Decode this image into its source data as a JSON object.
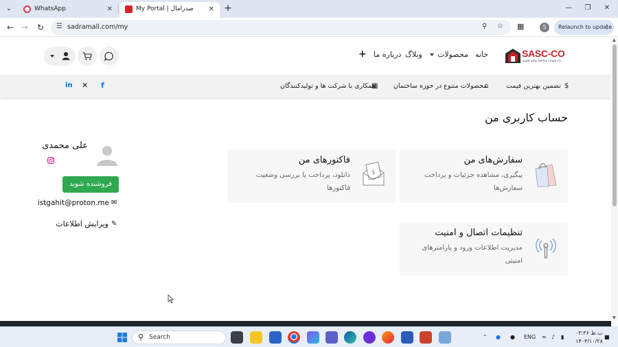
{
  "browser": {
    "tabs": [
      {
        "title": "WhatsApp",
        "active": false
      },
      {
        "title": "My Portal | صدرامال",
        "active": true
      }
    ],
    "url": "sadramall.com/my",
    "profile_initial": "S",
    "relaunch_label": "Relaunch to update"
  },
  "site": {
    "logo_name": "SASC-CO",
    "logo_sub": "SADR ASIA SUPPLY CHAIN CO",
    "menu": {
      "home": "خانه",
      "products": "محصولات",
      "blog": "وبلاگ",
      "about": "درباره ما"
    },
    "info": {
      "best_price": "تضمین بهترین قیمت",
      "variety": "محصولات متنوع در حوزه ساختمان",
      "partner": "همکاری با شرکت ها و تولیدکنندگان"
    },
    "social": [
      "facebook",
      "linkedin",
      "x",
      "instagram"
    ]
  },
  "account": {
    "page_title": "حساب کاربری من",
    "cards": [
      {
        "title": "سفارش‌های من",
        "desc": "پیگیری، مشاهده جزئیات و پرداخت سفارش‌ها",
        "icon": "shopping-bag-icon"
      },
      {
        "title": "فاکتورهای من",
        "desc": "دانلود، پرداخت یا بررسی وضعیت فاکتورها",
        "icon": "invoice-envelope-icon"
      },
      {
        "title": "تنظیمات اتصال و امنیت",
        "desc": "مدیریت اطلاعات ورود و پارامترهای امنیتی",
        "icon": "signal-tower-icon"
      }
    ],
    "profile": {
      "name": "علی محمدی",
      "become_seller": "فروشنده شوید",
      "email": "istgahit@proton.me",
      "edit_info": "ویرایش اطلاعات"
    }
  },
  "taskbar": {
    "search_placeholder": "Search",
    "language": "ENG",
    "time": "ب.ظ ۰۳:۳۶",
    "date": "۱۴۰۴/۱۰/۲۸"
  },
  "colors": {
    "brand_red": "#c4232a",
    "seller_green": "#2fa84f",
    "facebook": "#1877f2",
    "linkedin": "#0a66c2",
    "instagram": "#d6249f"
  }
}
